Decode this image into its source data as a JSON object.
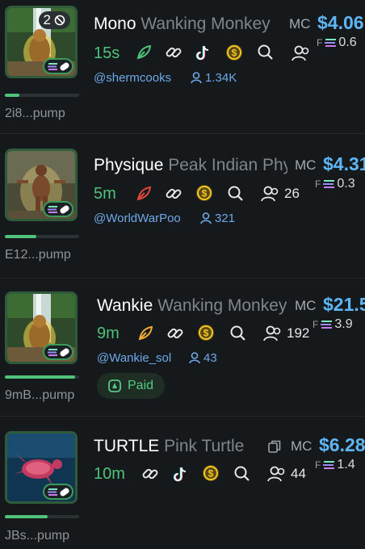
{
  "tokens": [
    {
      "symbol": "Mono",
      "name": "Wanking Monkey",
      "mc_label": "MC",
      "mc_value": "$4.06",
      "age": "15s",
      "holders": "",
      "f_value": "0.6",
      "handle": "@shermcooks",
      "followers": "1.34K",
      "address": "2i8...pump",
      "badge_count": "2",
      "progress": 0.2,
      "leaf_color": "#4fc37a",
      "icons": [
        "leaf-icon",
        "link-icon",
        "tiktok-icon",
        "dollar-coin-icon",
        "search-icon",
        "holders-icon"
      ]
    },
    {
      "symbol": "Physique",
      "name": "Peak Indian Physique",
      "mc_label": "MC",
      "mc_value": "$4.31",
      "age": "5m",
      "holders": "26",
      "f_value": "0.3",
      "handle": "@WorldWarPoo",
      "followers": "321",
      "address": "E12...pump",
      "progress": 0.42,
      "leaf_color": "#e0463c",
      "icons": [
        "leaf-icon",
        "link-icon",
        "dollar-coin-icon",
        "search-icon",
        "holders-icon"
      ]
    },
    {
      "symbol": "Wankie",
      "name": "Wanking Monkey",
      "mc_label": "MC",
      "mc_value": "$21.5",
      "age": "9m",
      "holders": "192",
      "f_value": "3.9",
      "handle": "@Wankie_sol",
      "followers": "43",
      "address": "9mB...pump",
      "progress": 0.95,
      "leaf_color": "#f0a93a",
      "paid_label": "Paid",
      "icons": [
        "leaf-icon",
        "link-icon",
        "dollar-coin-icon",
        "search-icon",
        "holders-icon"
      ]
    },
    {
      "symbol": "TURTLE",
      "name": "Pink Turtle",
      "mc_label": "MC",
      "mc_value": "$6.28",
      "age": "10m",
      "holders": "44",
      "f_value": "1.4",
      "address": "JBs...pump",
      "progress": 0.58,
      "icons": [
        "link-icon",
        "tiktok-icon",
        "dollar-coin-icon",
        "search-icon",
        "holders-icon",
        "copy-icon"
      ]
    }
  ],
  "colors": {
    "background": "#15191c",
    "accent_green": "#4fc37a",
    "mc_blue": "#5fb6f4",
    "handle_blue": "#6ea8e8",
    "coin_yellow": "#f3c623"
  }
}
